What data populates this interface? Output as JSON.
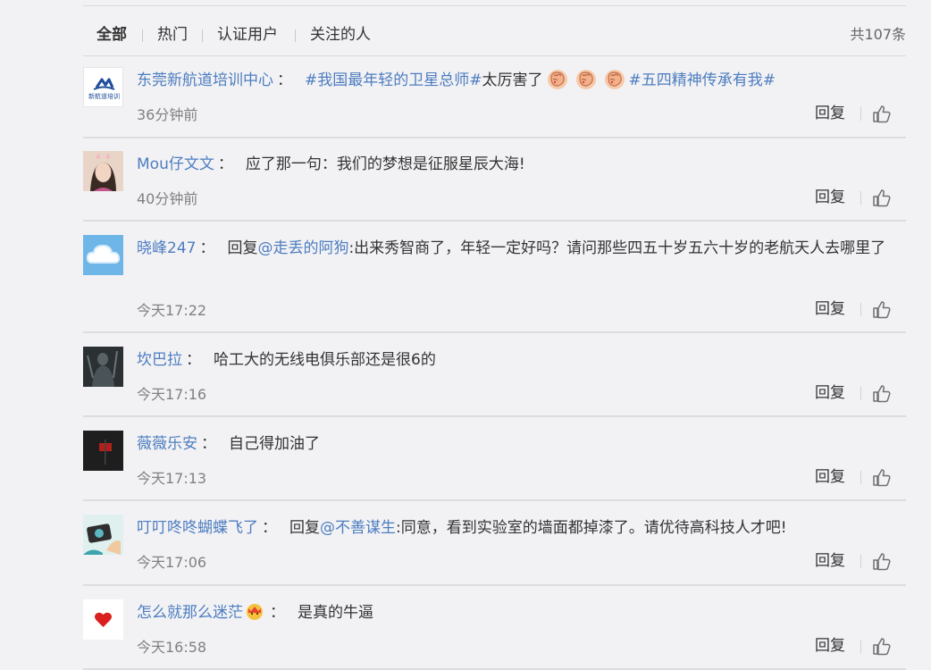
{
  "tabs": [
    {
      "label": "全部",
      "active": true
    },
    {
      "label": "热门",
      "active": false
    },
    {
      "label": "认证用户",
      "active": false
    },
    {
      "label": "关注的人",
      "active": false
    }
  ],
  "total_count": "共107条",
  "reply_label": "回复",
  "avatar_1_text": "新航道培训",
  "comments": [
    {
      "user": "东莞新航道培训中心",
      "colon": "：",
      "topic_1": "#我国最年轻的卫星总师#",
      "text_1": "太厉害了",
      "topic_2": "#五四精神传承有我#",
      "time": "36分钟前"
    },
    {
      "user": "Mou仔文文",
      "colon": "：",
      "text": "应了那一句：我们的梦想是征服星辰大海!",
      "time": "40分钟前"
    },
    {
      "user": "晓峰247",
      "colon": "：",
      "prefix": "回复",
      "mention": "@走丢的阿狗",
      "text": ":出来秀智商了，年轻一定好吗？请问那些四五十岁五六十岁的老航天人去哪里了",
      "time": "今天17:22"
    },
    {
      "user": "坎巴拉",
      "colon": "：",
      "text": "哈工大的无线电俱乐部还是很6的",
      "time": "今天17:16"
    },
    {
      "user": "薇薇乐安",
      "colon": "：",
      "text": "自己得加油了",
      "time": "今天17:13"
    },
    {
      "user": "叮叮咚咚蝴蝶飞了",
      "colon": "：",
      "prefix": "回复",
      "mention": "@不善谋生",
      "text": ":同意，看到实验室的墙面都掉漆了。请优待高科技人才吧!",
      "time": "今天17:06"
    },
    {
      "user": "怎么就那么迷茫",
      "colon": "：",
      "text": "是真的牛逼",
      "time": "今天16:58"
    }
  ]
}
